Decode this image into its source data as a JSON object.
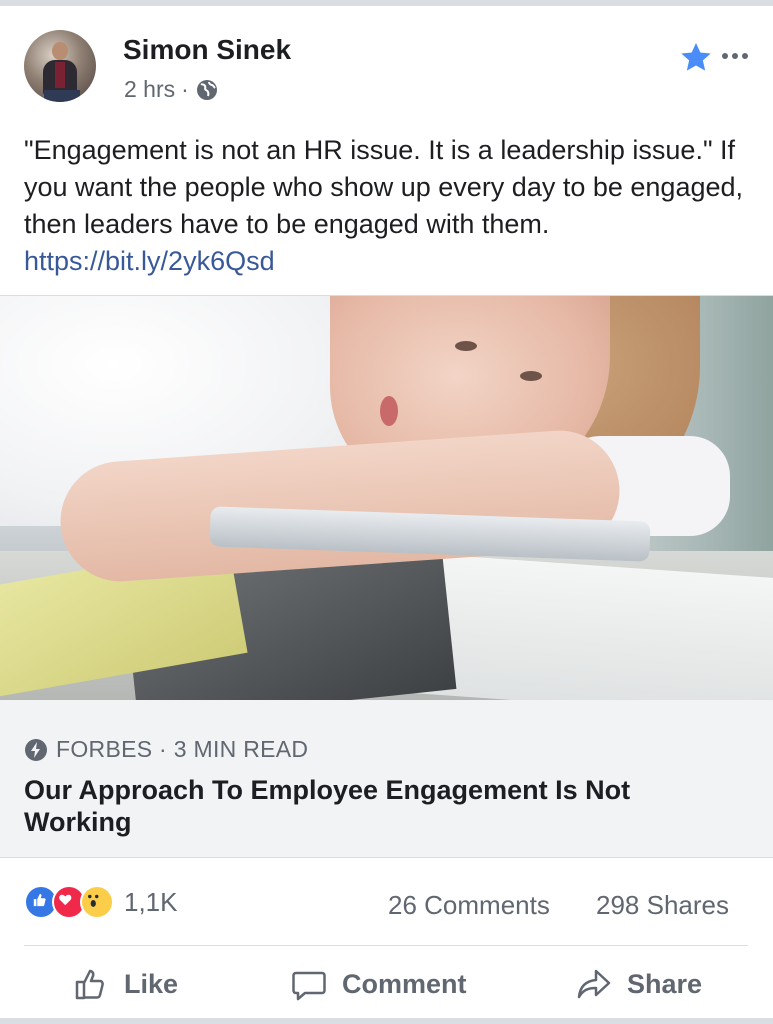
{
  "post": {
    "author": "Simon Sinek",
    "time": "2 hrs",
    "separator": "·",
    "text": "\"Engagement is not an HR issue. It is a leadership issue.\" If you want the people who show up every day to be engaged, then leaders have to be engaged with them. ",
    "link": "https://bit.ly/2yk6Qsd"
  },
  "preview": {
    "source": "FORBES · 3 MIN READ",
    "title": "Our Approach To Employee Engagement Is Not Working"
  },
  "stats": {
    "reactions_count": "1,1K",
    "reaction_types": [
      "like",
      "love",
      "wow"
    ],
    "comments": "26 Comments",
    "shares": "298 Shares"
  },
  "actions": {
    "like": "Like",
    "comment": "Comment",
    "share": "Share"
  },
  "colors": {
    "link": "#385898",
    "star": "#4a8df8",
    "like_blue": "#3578e5",
    "love_red": "#f0284a",
    "wow_yellow": "#fbcd48",
    "secondary_text": "#606770"
  },
  "icons": {
    "privacy": "globe-icon",
    "favorite": "star-icon",
    "menu": "more-icon",
    "source": "bolt-icon"
  }
}
